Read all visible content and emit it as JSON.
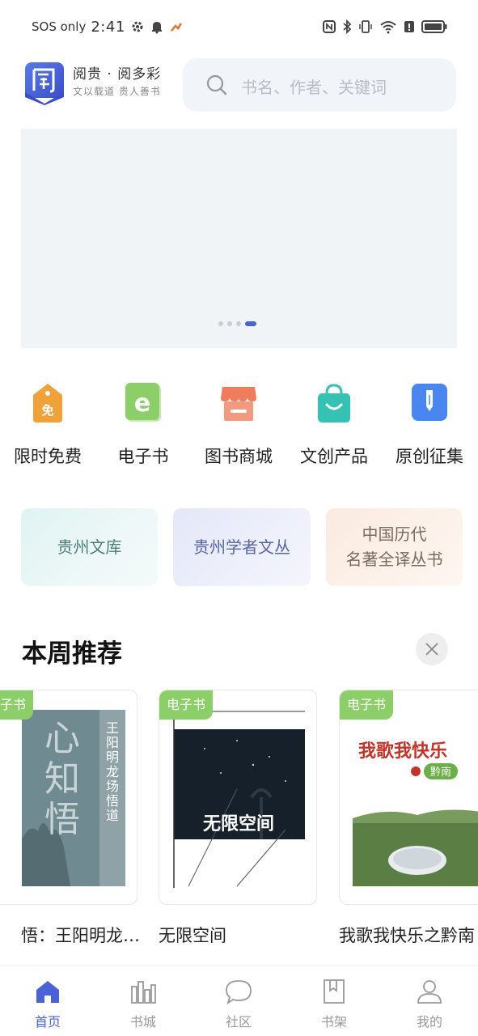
{
  "status_bar": {
    "carrier": "SOS only",
    "time": "2:41"
  },
  "header": {
    "brand_title": "阅贵 · 阅多彩",
    "brand_subtitle": "文以载道 贵人善书",
    "search_placeholder": "书名、作者、关键词"
  },
  "banner": {
    "page_count": 4,
    "active_page": 4
  },
  "categories": [
    {
      "label": "限时免费",
      "icon": "free-tag-icon",
      "color": "#f0a13a"
    },
    {
      "label": "电子书",
      "icon": "ebook-icon",
      "color": "#8ccf69"
    },
    {
      "label": "图书商城",
      "icon": "store-icon",
      "color": "#ee7d5e"
    },
    {
      "label": "文创产品",
      "icon": "shopping-bag-icon",
      "color": "#35c2b5"
    },
    {
      "label": "原创征集",
      "icon": "pen-icon",
      "color": "#4a86f0"
    }
  ],
  "collections": [
    {
      "line1": "贵州文库",
      "line2": ""
    },
    {
      "line1": "贵州学者文丛",
      "line2": ""
    },
    {
      "line1": "中国历代",
      "line2": "名著全译丛书"
    }
  ],
  "weekly": {
    "title": "本周推荐",
    "books": [
      {
        "tag": "电子书",
        "title": "心知悟：王阳明龙场悟道",
        "title_visible": "悟：王阳明龙…",
        "cover_text_big": "心知悟",
        "cover_text_side": "王阳明龙场悟道"
      },
      {
        "tag": "电子书",
        "title": "无限空间",
        "title_visible": "无限空间",
        "cover_text_big": "无限空间"
      },
      {
        "tag": "电子书",
        "title": "我歌我快乐之黔南",
        "title_visible": "我歌我快乐之黔南",
        "cover_text_big": "我歌我快乐",
        "cover_text_small": "黔南"
      }
    ]
  },
  "bottom_nav": [
    {
      "label": "首页",
      "icon": "home-icon",
      "active": true
    },
    {
      "label": "书城",
      "icon": "bookstore-icon",
      "active": false
    },
    {
      "label": "社区",
      "icon": "chat-bubble-icon",
      "active": false
    },
    {
      "label": "书架",
      "icon": "bookmark-shelf-icon",
      "active": false
    },
    {
      "label": "我的",
      "icon": "profile-icon",
      "active": false
    }
  ],
  "colors": {
    "accent": "#4a62d8",
    "tag_green": "#8ccf69"
  }
}
